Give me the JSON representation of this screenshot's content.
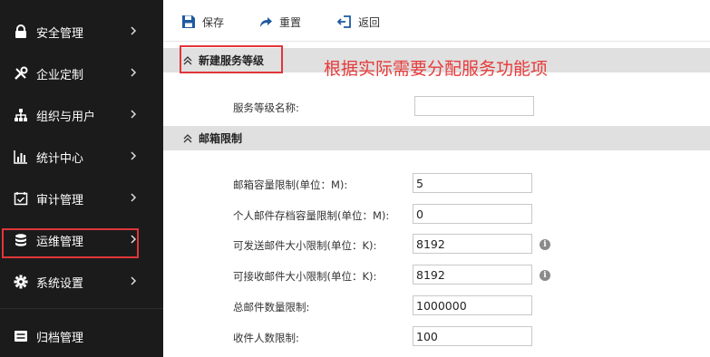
{
  "sidebar": {
    "items": [
      {
        "label": "安全管理",
        "icon": "lock-icon"
      },
      {
        "label": "企业定制",
        "icon": "tools-icon"
      },
      {
        "label": "组织与用户",
        "icon": "org-chart-icon"
      },
      {
        "label": "统计中心",
        "icon": "bar-chart-icon"
      },
      {
        "label": "审计管理",
        "icon": "calendar-check-icon"
      },
      {
        "label": "运维管理",
        "icon": "database-icon"
      },
      {
        "label": "系统设置",
        "icon": "gear-icon"
      },
      {
        "label": "归档管理",
        "icon": "archive-icon"
      }
    ]
  },
  "toolbar": {
    "save_label": "保存",
    "reset_label": "重置",
    "back_label": "返回"
  },
  "annotation": "根据实际需要分配服务功能项",
  "sections": {
    "new_level": {
      "title": "新建服务等级",
      "name_label": "服务等级名称:",
      "name_value": ""
    },
    "mailbox": {
      "title": "邮箱限制",
      "fields": [
        {
          "label": "邮箱容量限制(单位：M):",
          "value": "5"
        },
        {
          "label": "个人邮件存档容量限制(单位：M):",
          "value": "0"
        },
        {
          "label": "可发送邮件大小限制(单位：K):",
          "value": "8192"
        },
        {
          "label": "可接收邮件大小限制(单位：K):",
          "value": "8192"
        },
        {
          "label": "总邮件数量限制:",
          "value": "1000000"
        },
        {
          "label": "收件人数限制:",
          "value": "100"
        }
      ]
    }
  },
  "colors": {
    "sidebar_bg": "#1b1b1b",
    "highlight_red": "#e0363a",
    "toolbar_icon_blue": "#1f5aa0",
    "section_header_bg": "#e0e0e0"
  }
}
